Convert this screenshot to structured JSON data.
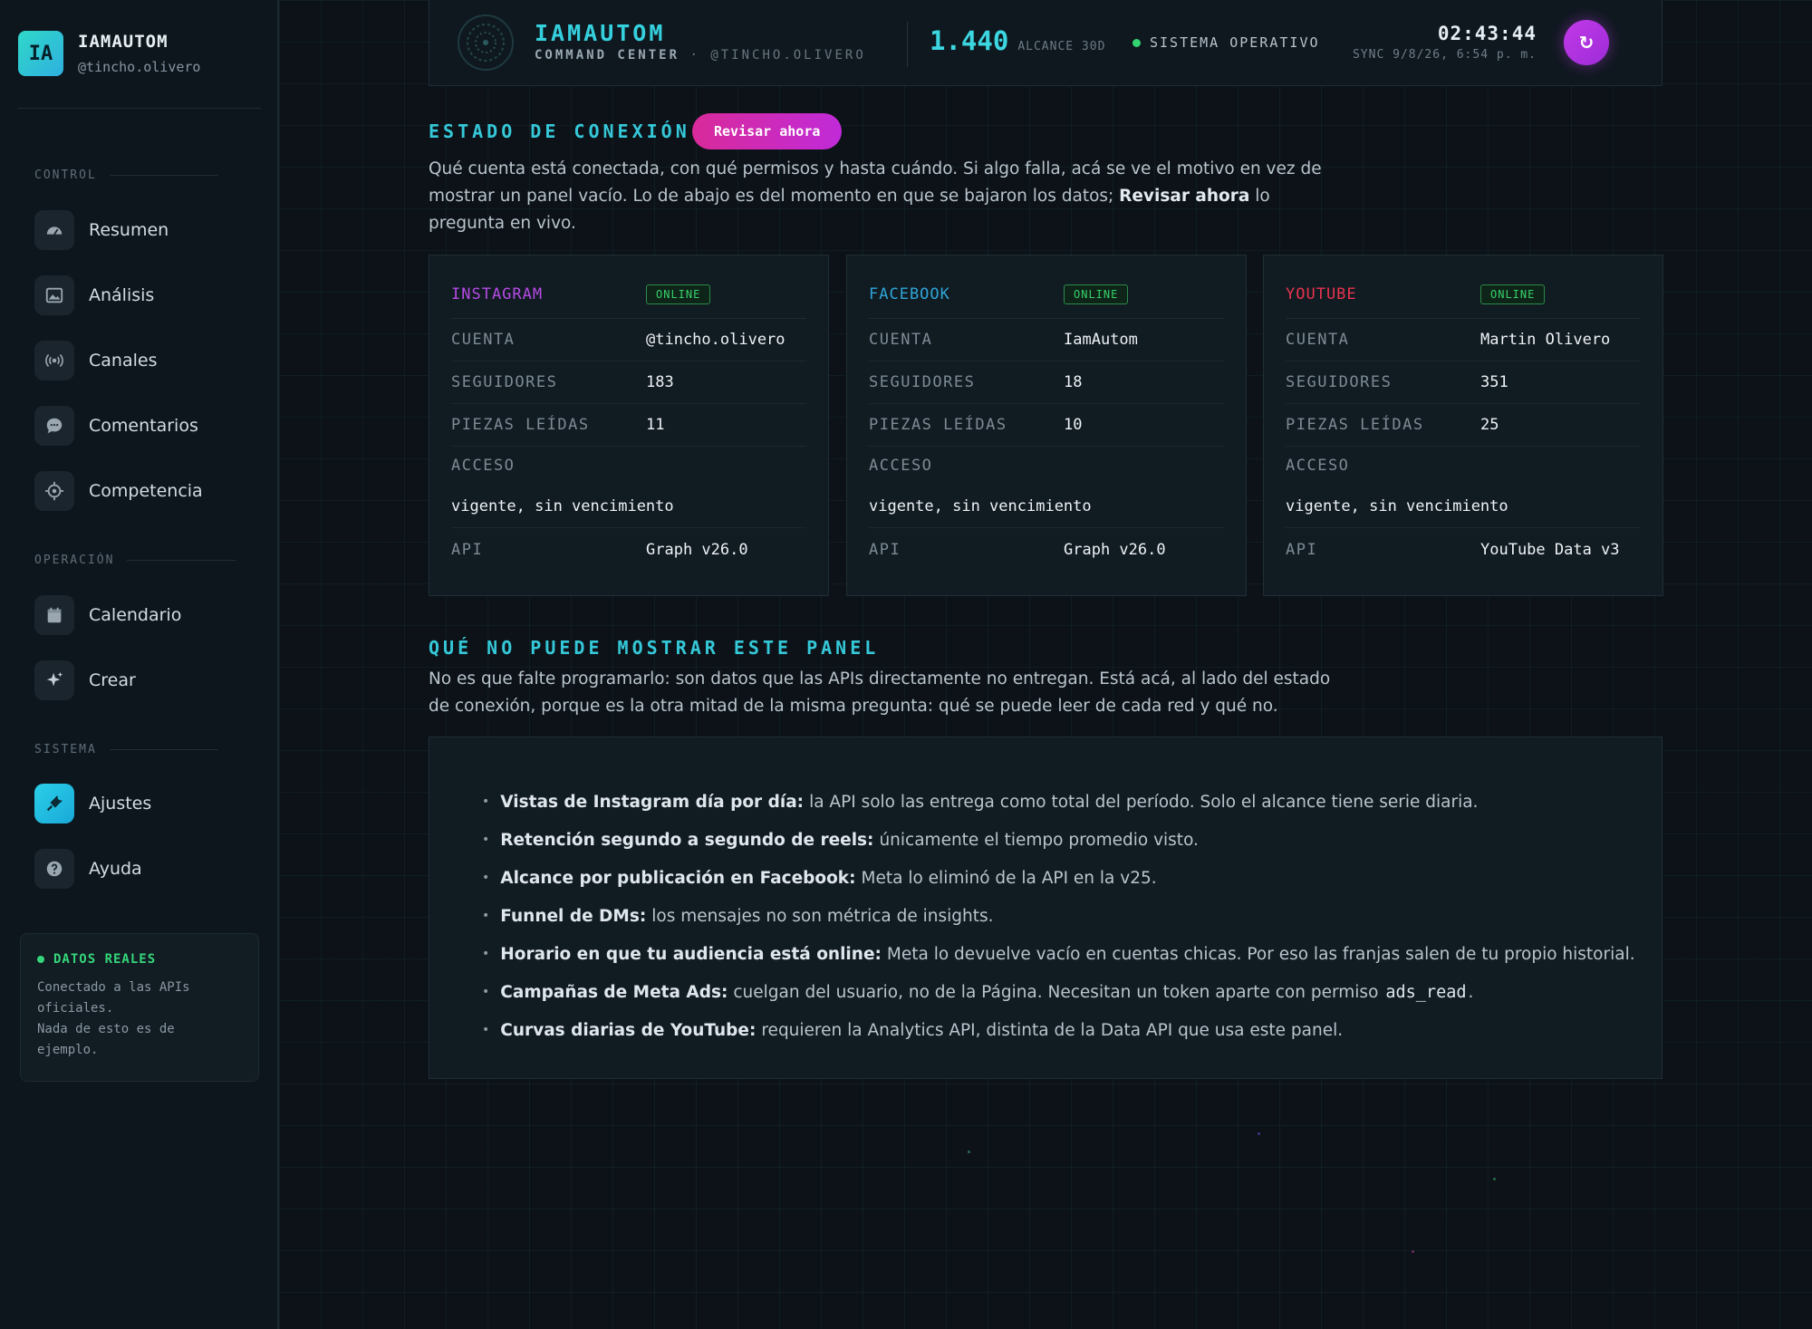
{
  "brand": {
    "badge": "IA",
    "name": "IAMAUTOM",
    "handle": "@tincho.olivero"
  },
  "sidebar": {
    "sections": [
      {
        "label": "CONTROL",
        "items": [
          {
            "label": "Resumen",
            "icon": "gauge-icon"
          },
          {
            "label": "Análisis",
            "icon": "image-chart-icon"
          },
          {
            "label": "Canales",
            "icon": "broadcast-icon"
          },
          {
            "label": "Comentarios",
            "icon": "chat-icon"
          },
          {
            "label": "Competencia",
            "icon": "target-icon"
          }
        ]
      },
      {
        "label": "OPERACIÓN",
        "items": [
          {
            "label": "Calendario",
            "icon": "calendar-icon"
          },
          {
            "label": "Crear",
            "icon": "sparkle-icon"
          }
        ]
      },
      {
        "label": "SISTEMA",
        "items": [
          {
            "label": "Ajustes",
            "icon": "plug-icon",
            "active": true
          },
          {
            "label": "Ayuda",
            "icon": "help-icon"
          }
        ]
      }
    ],
    "real_box": {
      "title": "DATOS REALES",
      "line1": "Conectado a las APIs oficiales.",
      "line2": "Nada de esto es de ejemplo."
    }
  },
  "header": {
    "title": "IAMAUTOM",
    "subtitle": "COMMAND CENTER",
    "subtitle_sep": " · ",
    "subtitle_handle": "@TINCHO.OLIVERO",
    "reach_value": "1.440",
    "reach_label": "ALCANCE 30D",
    "status": "SISTEMA OPERATIVO",
    "time": "02:43:44",
    "sync": "SYNC 9/8/26, 6:54 p. m.",
    "refresh_icon": "↻"
  },
  "connection": {
    "title": "ESTADO DE CONEXIÓN",
    "button": "Revisar ahora",
    "para_a": "Qué cuenta está conectada, con qué permisos y hasta cuándo. Si algo falla, acá se ve el motivo en vez de mostrar un panel vacío. Lo de abajo es del momento en que se bajaron los datos; ",
    "para_b": "Revisar ahora",
    "para_c": " lo pregunta en vivo."
  },
  "cards": [
    {
      "network": "INSTAGRAM",
      "color": "#b54be6",
      "status": "ONLINE",
      "rows": {
        "cuenta_k": "CUENTA",
        "cuenta_v": "@tincho.olivero",
        "seg_k": "SEGUIDORES",
        "seg_v": "183",
        "piezas_k": "PIEZAS LEÍDAS",
        "piezas_v": "11",
        "acceso_k": "ACCESO",
        "acceso_v": "vigente, sin vencimiento",
        "api_k": "API",
        "api_v": "Graph v26.0"
      }
    },
    {
      "network": "FACEBOOK",
      "color": "#2fa6d8",
      "status": "ONLINE",
      "rows": {
        "cuenta_k": "CUENTA",
        "cuenta_v": "IamAutom",
        "seg_k": "SEGUIDORES",
        "seg_v": "18",
        "piezas_k": "PIEZAS LEÍDAS",
        "piezas_v": "10",
        "acceso_k": "ACCESO",
        "acceso_v": "vigente, sin vencimiento",
        "api_k": "API",
        "api_v": "Graph v26.0"
      }
    },
    {
      "network": "YOUTUBE",
      "color": "#e8344f",
      "status": "ONLINE",
      "rows": {
        "cuenta_k": "CUENTA",
        "cuenta_v": "Martin Olivero",
        "seg_k": "SEGUIDORES",
        "seg_v": "351",
        "piezas_k": "PIEZAS LEÍDAS",
        "piezas_v": "25",
        "acceso_k": "ACCESO",
        "acceso_v": "vigente, sin vencimiento",
        "api_k": "API",
        "api_v": "YouTube Data v3"
      }
    }
  ],
  "limits": {
    "title": "QUÉ NO PUEDE MOSTRAR ESTE PANEL",
    "para": "No es que falte programarlo: son datos que las APIs directamente no entregan. Está acá, al lado del estado de conexión, porque es la otra mitad de la misma pregunta: qué se puede leer de cada red y qué no.",
    "items": [
      {
        "bold": "Vistas de Instagram día por día:",
        "text": "la API solo las entrega como total del período. Solo el alcance tiene serie diaria."
      },
      {
        "bold": "Retención segundo a segundo de reels:",
        "text": "únicamente el tiempo promedio visto."
      },
      {
        "bold": "Alcance por publicación en Facebook:",
        "text": "Meta lo eliminó de la API en la v25."
      },
      {
        "bold": "Funnel de DMs:",
        "text": "los mensajes no son métrica de insights."
      },
      {
        "bold": "Horario en que tu audiencia está online:",
        "text": "Meta lo devuelve vacío en cuentas chicas. Por eso las franjas salen de tu propio historial."
      },
      {
        "bold": "Campañas de Meta Ads:",
        "text": "cuelgan del usuario, no de la Página. Necesitan un token aparte con permiso",
        "code": "ads_read",
        "tail": "."
      },
      {
        "bold": "Curvas diarias de YouTube:",
        "text": "requieren la Analytics API, distinta de la Data API que usa este panel."
      }
    ]
  }
}
